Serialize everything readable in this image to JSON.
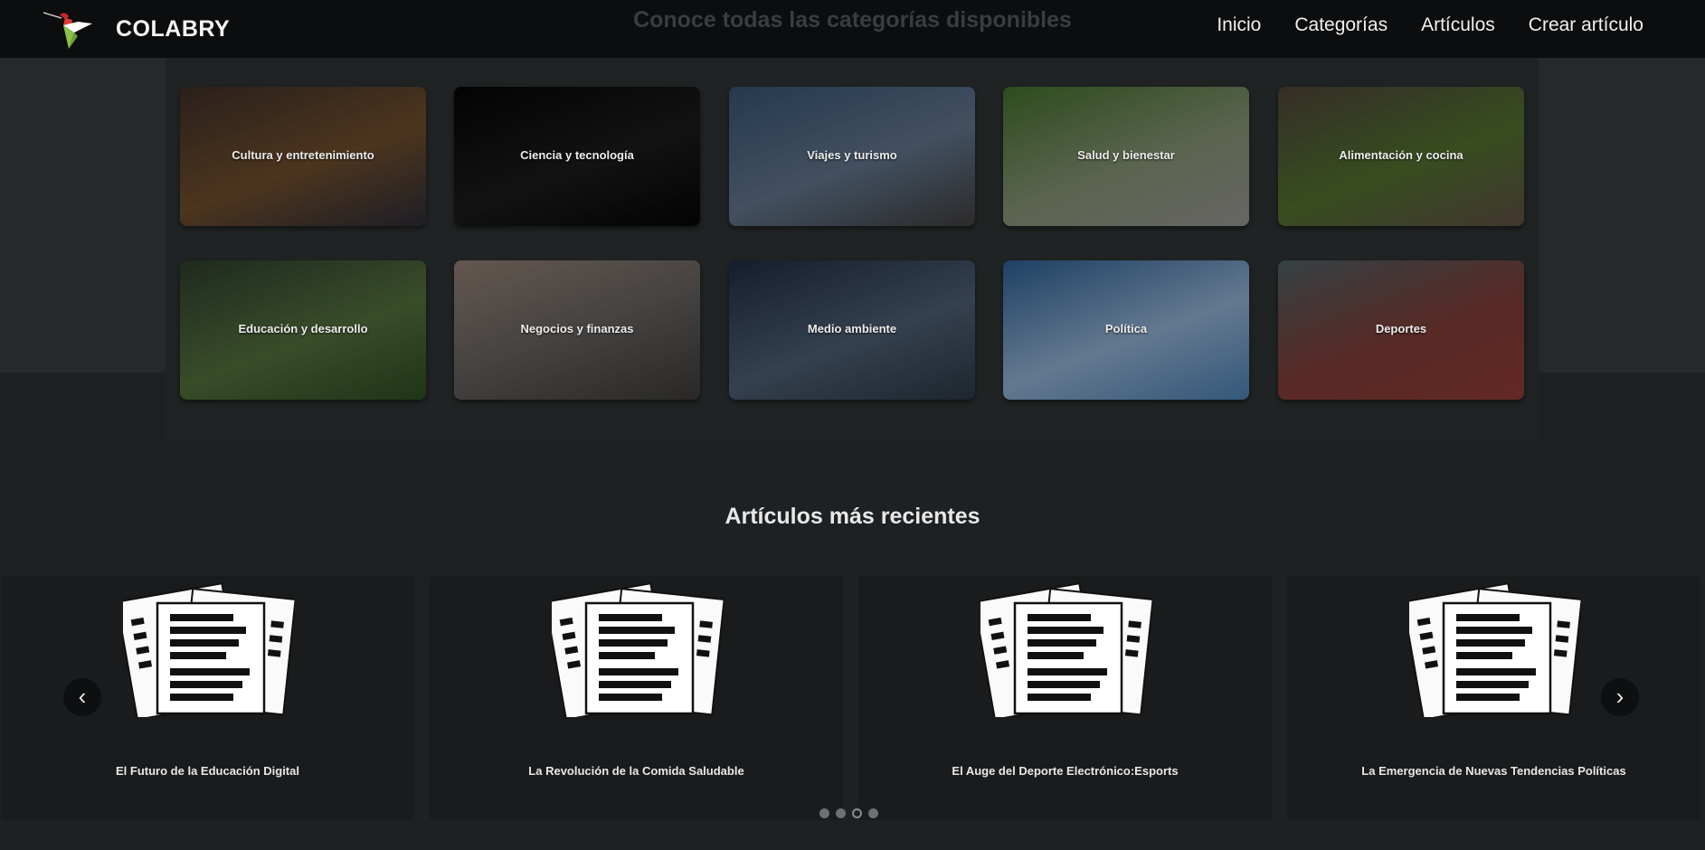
{
  "navbar": {
    "brand": "COLABRY",
    "links": [
      "Inicio",
      "Categorías",
      "Artículos",
      "Crear artículo"
    ]
  },
  "categories": {
    "heading": "Conoce todas las categorías disponibles",
    "items": [
      {
        "label": "Cultura y entretenimiento",
        "colors": [
          "#3b2d26",
          "#6b4a2a",
          "#2a2a35"
        ]
      },
      {
        "label": "Ciencia y tecnología",
        "colors": [
          "#050505",
          "#1a1a1a",
          "#050505"
        ]
      },
      {
        "label": "Viajes y turismo",
        "colors": [
          "#34506e",
          "#5d6f86",
          "#3c3b3a"
        ]
      },
      {
        "label": "Salud y bienestar",
        "colors": [
          "#3f6a2a",
          "#7f8b6e",
          "#8e8e8c"
        ]
      },
      {
        "label": "Alimentación y cocina",
        "colors": [
          "#4a4035",
          "#4e6b2d",
          "#5a4c40"
        ]
      },
      {
        "label": "Educación y desarrollo",
        "colors": [
          "#2c3a2a",
          "#4f6b3a",
          "#2b4a20"
        ]
      },
      {
        "label": "Negocios y finanzas",
        "colors": [
          "#8a7a70",
          "#5d5a58",
          "#3a3835"
        ]
      },
      {
        "label": "Medio ambiente",
        "colors": [
          "#1d2a3d",
          "#4a5a6e",
          "#2a3440"
        ]
      },
      {
        "label": "Política",
        "colors": [
          "#2c5a8a",
          "#8aa8c8",
          "#4a7aa8"
        ]
      },
      {
        "label": "Deportes",
        "colors": [
          "#4a5a5e",
          "#7a3a34",
          "#8a3a34"
        ]
      }
    ]
  },
  "recent": {
    "heading": "Artículos más recientes",
    "articles": [
      {
        "title": "El Futuro de la Educación Digital"
      },
      {
        "title": "La Revolución de la Comida Saludable"
      },
      {
        "title": "El Auge del Deporte Electrónico:Esports"
      },
      {
        "title": "La Emergencia de Nuevas Tendencias Políticas"
      }
    ],
    "prev_icon": "‹",
    "next_icon": "›",
    "dot_count": 4,
    "active_dot": 2
  }
}
